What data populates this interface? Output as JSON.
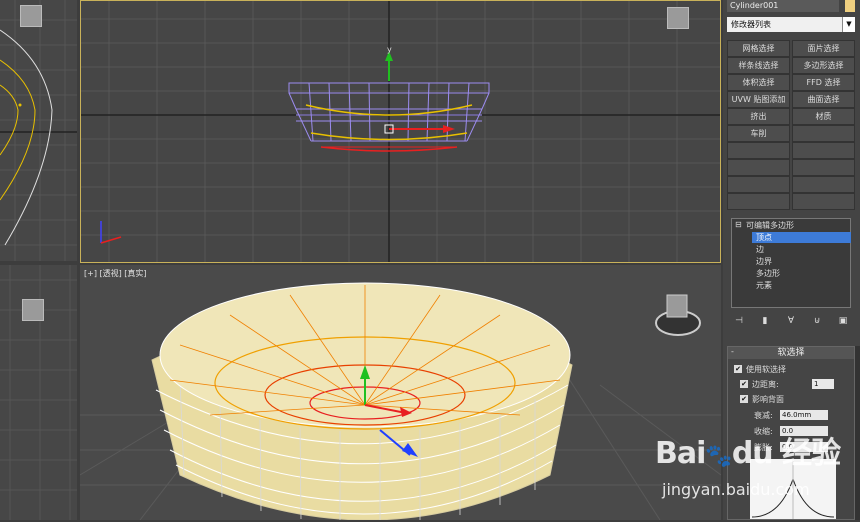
{
  "object_name": "Cylinder001",
  "object_color": "#f0d080",
  "modifier_list": "修改器列表",
  "modifier_buttons": [
    "网格选择",
    "面片选择",
    "样条线选择",
    "多边形选择",
    "体积选择",
    "FFD 选择",
    "UVW 贴图添加",
    "曲面选择",
    "挤出",
    "材质",
    "车削",
    "",
    "",
    "",
    "",
    "",
    "",
    "",
    "",
    ""
  ],
  "stack": {
    "base": "可编辑多边形",
    "items": [
      "顶点",
      "边",
      "边界",
      "多边形",
      "元素"
    ]
  },
  "viewports": {
    "persp_label": "[+] [透视] [真实]",
    "front_axis": "y"
  },
  "soft_selection": {
    "title": "软选择",
    "use_soft": "使用软选择",
    "edge_distance": "边距离:",
    "edge_distance_value": "1",
    "affect_backfacing": "影响背面",
    "falloff_label": "衰减:",
    "falloff_value": "46.0mm",
    "pinch_label": "收缩:",
    "pinch_value": "0.0",
    "bubble_label": "膨胀:",
    "bubble_value": "0.0"
  },
  "watermark": {
    "logo": "Bai 经验",
    "url": "jingyan.baidu.com"
  }
}
